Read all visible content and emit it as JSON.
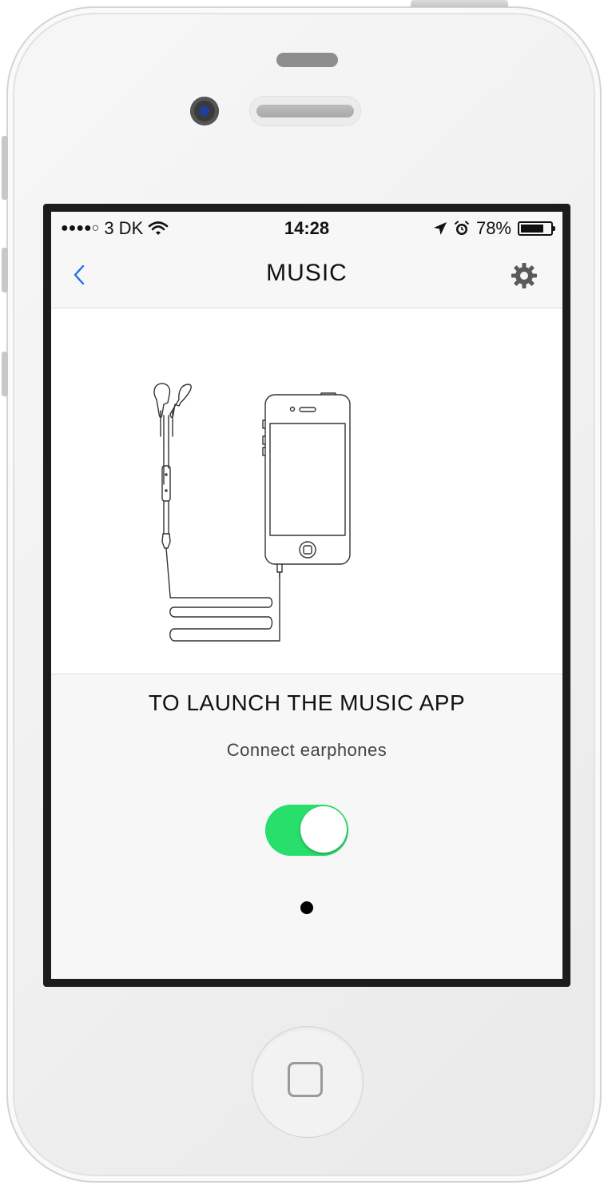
{
  "status_bar": {
    "signal_dots": "●●●●○",
    "carrier": "3 DK",
    "time": "14:28",
    "battery_percent": "78%",
    "battery_level": 0.78
  },
  "nav": {
    "title": "MUSIC",
    "back_icon": "chevron-left-icon",
    "settings_icon": "gear-icon"
  },
  "content": {
    "headline": "TO LAUNCH THE MUSIC APP",
    "subtext": "Connect earphones",
    "toggle_on": true,
    "page_index": 1,
    "page_count": 1
  },
  "colors": {
    "accent": "#1c6ef2",
    "toggle_on": "#28df6b"
  }
}
